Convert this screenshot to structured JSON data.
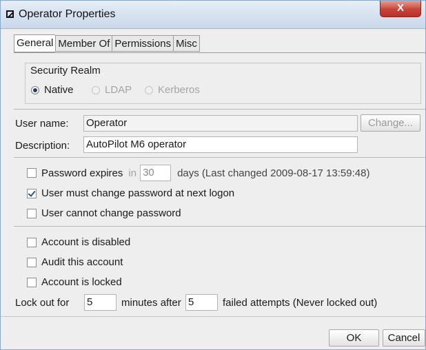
{
  "window": {
    "title": "Operator Properties",
    "close_glyph": "X"
  },
  "tabs": [
    {
      "label": "General",
      "active": true
    },
    {
      "label": "Member Of",
      "active": false
    },
    {
      "label": "Permissions",
      "active": false
    },
    {
      "label": "Misc",
      "active": false
    }
  ],
  "security_realm": {
    "label": "Security Realm",
    "options": [
      {
        "label": "Native",
        "selected": true,
        "enabled": true
      },
      {
        "label": "LDAP",
        "selected": false,
        "enabled": false
      },
      {
        "label": "Kerberos",
        "selected": false,
        "enabled": false
      }
    ]
  },
  "user": {
    "username_label": "User name:",
    "username_value": "Operator",
    "change_button": "Change...",
    "description_label": "Description:",
    "description_value": "AutoPilot M6 operator"
  },
  "password": {
    "expires_label": "Password expires",
    "in_label": "in",
    "days_value": "30",
    "days_suffix": "days (Last changed 2009-08-17 13:59:48)",
    "expires_checked": false,
    "must_change_label": "User must change password at next logon",
    "must_change_checked": true,
    "cannot_change_label": "User cannot change password",
    "cannot_change_checked": false
  },
  "account": {
    "disabled_label": "Account is disabled",
    "disabled_checked": false,
    "audit_label": "Audit this account",
    "audit_checked": false,
    "locked_label": "Account is locked",
    "locked_checked": false,
    "lockout_prefix": "Lock out for",
    "lockout_minutes": "5",
    "lockout_middle": "minutes after",
    "lockout_attempts": "5",
    "lockout_suffix": "failed attempts (Never locked out)"
  },
  "footer": {
    "ok": "OK",
    "cancel": "Cancel"
  },
  "colors": {
    "accent": "#1f3c78",
    "close": "#c8443a",
    "title_bar": "#c9d8ea"
  }
}
